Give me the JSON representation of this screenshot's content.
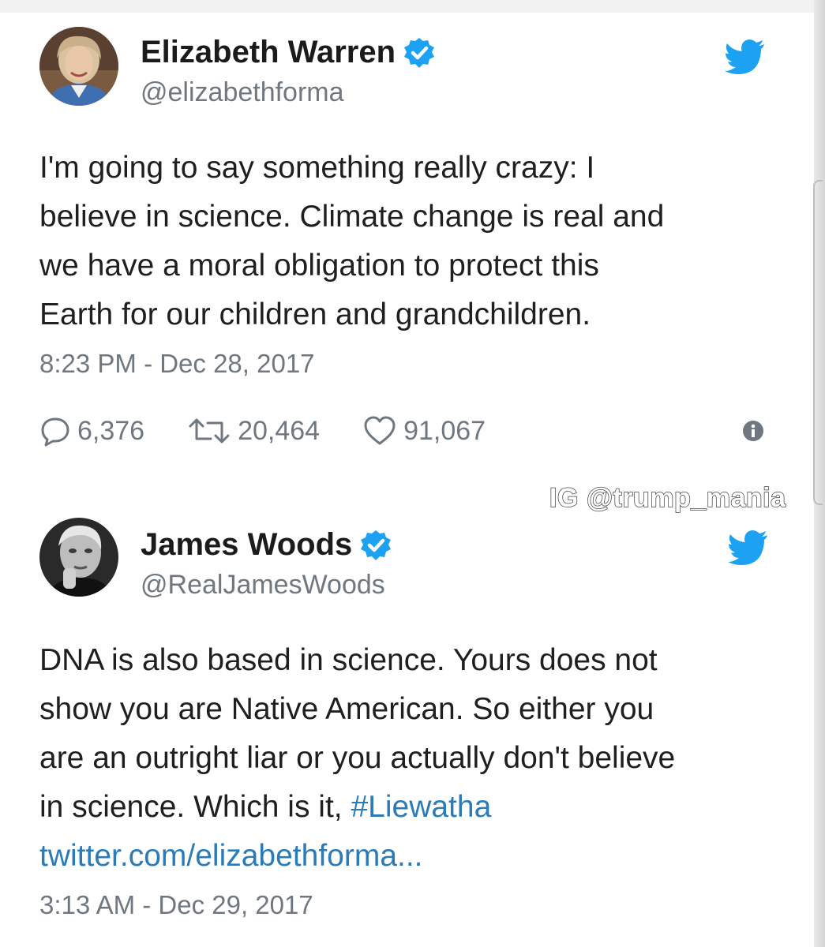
{
  "tweets": [
    {
      "author": {
        "display_name": "Elizabeth Warren",
        "handle": "@elizabethforma",
        "verified": true,
        "avatar_icon": "woman-portrait-avatar"
      },
      "text_lines": [
        "I'm going to say something really crazy: I",
        "believe in science. Climate change is real and",
        "we have a moral obligation to protect this",
        "Earth for our children and grandchildren."
      ],
      "timestamp": "8:23 PM - Dec 28, 2017",
      "stats": {
        "replies": "6,376",
        "retweets": "20,464",
        "likes": "91,067"
      }
    },
    {
      "author": {
        "display_name": "James Woods",
        "handle": "@RealJamesWoods",
        "verified": true,
        "avatar_icon": "man-bw-portrait-avatar"
      },
      "text_lines": [
        "DNA is also based in science. Yours does not",
        "show you are Native American. So either you",
        "are an outright liar or you actually don't believe"
      ],
      "text_last_line_prefix": "in science. Which is it, ",
      "hashtag": "#Liewatha",
      "link": "twitter.com/elizabethforma...",
      "timestamp": "3:13 AM - Dec 29, 2017"
    }
  ],
  "watermark": "IG @trump_mania",
  "colors": {
    "twitter_blue": "#1da1f2",
    "link_blue": "#2b7bb9",
    "meta_gray": "#6f7780",
    "text": "#1f1f1f"
  },
  "icons": [
    "verified-badge-icon",
    "twitter-bird-icon",
    "reply-icon",
    "retweet-icon",
    "like-heart-icon",
    "info-icon"
  ]
}
